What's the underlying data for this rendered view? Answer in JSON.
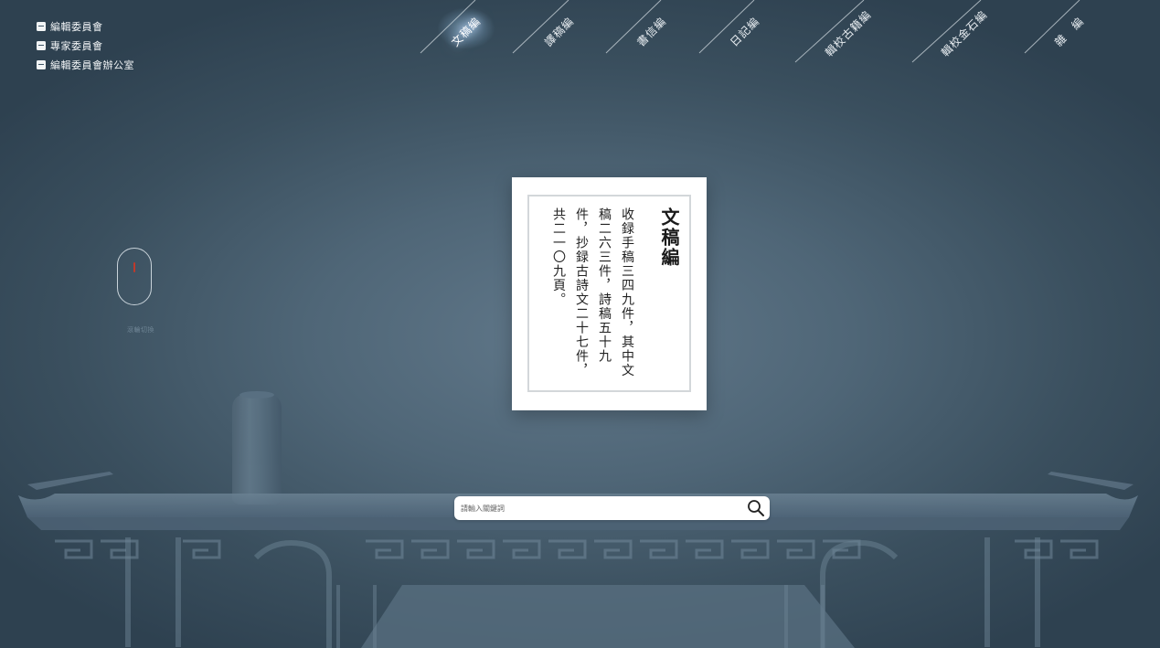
{
  "side_links": [
    {
      "label": "編輯委員會"
    },
    {
      "label": "專家委員會"
    },
    {
      "label": "編輯委員會辦公室"
    }
  ],
  "nav": {
    "items": [
      {
        "label": "文稿編",
        "active": true
      },
      {
        "label": "譯稿編",
        "active": false
      },
      {
        "label": "書信編",
        "active": false
      },
      {
        "label": "日記編",
        "active": false
      },
      {
        "label": "輯校古籍編",
        "active": false
      },
      {
        "label": "輯校金石編",
        "active": false
      },
      {
        "label": "雜　編",
        "active": false
      }
    ]
  },
  "scroll_hint": "滾輪切換",
  "card": {
    "title": "文稿編",
    "body": "收録手稿三四九件，其中文稿二六三件，詩稿五十九件，抄録古詩文二十七件，共二一〇九頁。"
  },
  "search": {
    "placeholder": "請輸入關鍵詞"
  },
  "colors": {
    "background": "#4f6677",
    "accent_red": "#c0392b"
  }
}
